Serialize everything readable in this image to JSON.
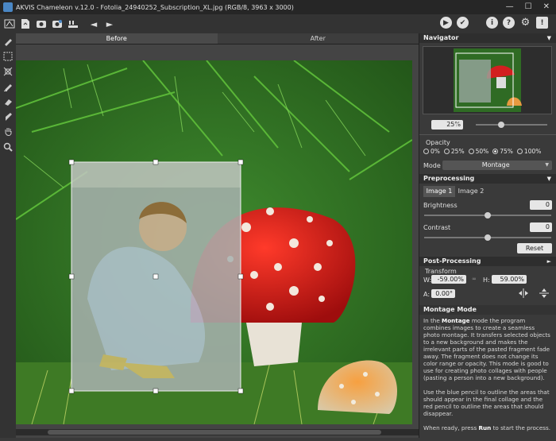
{
  "window": {
    "title": "AKVIS Chameleon v.12.0 - Fotolia_24940252_Subscription_XL.jpg (RGB/8, 3963 x 3000)",
    "minimize": "—",
    "maximize": "☐",
    "close": "✕"
  },
  "toolbar": {
    "back": "◄",
    "forward": "►",
    "run": "▶",
    "apply": "✔",
    "about": "i",
    "help": "?",
    "settings": "⚙",
    "notify": "!"
  },
  "tabs": {
    "before": "Before",
    "after": "After"
  },
  "navigator": {
    "title": "Navigator",
    "zoom": "25%"
  },
  "opacity": {
    "label": "Opacity",
    "options": [
      "0%",
      "25%",
      "50%",
      "75%",
      "100%"
    ],
    "selected": "75%"
  },
  "mode": {
    "label": "Mode",
    "value": "Montage"
  },
  "preprocessing": {
    "title": "Preprocessing",
    "tab1": "Image 1",
    "tab2": "Image 2",
    "brightness_label": "Brightness",
    "brightness": "0",
    "contrast_label": "Contrast",
    "contrast": "0",
    "reset": "Reset"
  },
  "postprocessing": {
    "title": "Post-Processing"
  },
  "transform": {
    "title": "Transform",
    "w_label": "W:",
    "w": "-59.00%",
    "h_label": "H:",
    "h": "59.00%",
    "a_label": "A:",
    "a": "0.00°"
  },
  "mode_help": {
    "title": "Montage Mode",
    "p1_a": "In the ",
    "p1_b": "Montage",
    "p1_c": " mode the program combines images to create a seamless photo montage. It transfers selected objects to a new background and makes the irrelevant parts of the pasted fragment fade away. The fragment does not change its color range or opacity. This mode is good to use for creating photo collages with people (pasting a person into a new background).",
    "p2": "Use the blue pencil to outline the areas that should appear in the final collage and the red pencil to outline the areas that should disappear.",
    "p3_a": "When ready, press ",
    "p3_b": "Run",
    "p3_c": " to start the process."
  },
  "colors": {
    "panel": "#3a3a3a",
    "accent": "#4a87c5",
    "mushroom_red": "#d21f1f"
  }
}
